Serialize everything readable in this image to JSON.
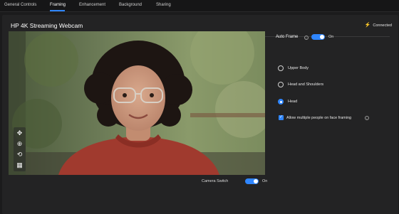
{
  "tabs": [
    {
      "label": "General Controls",
      "active": false
    },
    {
      "label": "Framing",
      "active": true
    },
    {
      "label": "Enhancement",
      "active": false
    },
    {
      "label": "Background",
      "active": false
    },
    {
      "label": "Sharing",
      "active": false
    }
  ],
  "header": {
    "title": "HP 4K Streaming Webcam",
    "status": "Connected",
    "status_icon": "plug-icon",
    "status_color": "#4ec24a"
  },
  "preview_tools": [
    {
      "icon": "move-icon",
      "glyph": "✥"
    },
    {
      "icon": "zoom-in-icon",
      "glyph": "⊕"
    },
    {
      "icon": "rotate-icon",
      "glyph": "⟲"
    },
    {
      "icon": "grid-icon",
      "glyph": "▦"
    }
  ],
  "camera_switch": {
    "label": "Camera Switch",
    "state": "On",
    "enabled": true
  },
  "auto_frame": {
    "label": "Auto Frame",
    "state": "On",
    "enabled": true
  },
  "framing_options": [
    {
      "label": "Upper Body",
      "selected": false
    },
    {
      "label": "Head and Shoulders",
      "selected": false
    },
    {
      "label": "Head",
      "selected": true
    }
  ],
  "multi_person": {
    "label": "Allow multiple people on face framing",
    "checked": true
  },
  "colors": {
    "accent": "#2f86ff",
    "panel": "#232324",
    "background": "#1b1b1c"
  }
}
